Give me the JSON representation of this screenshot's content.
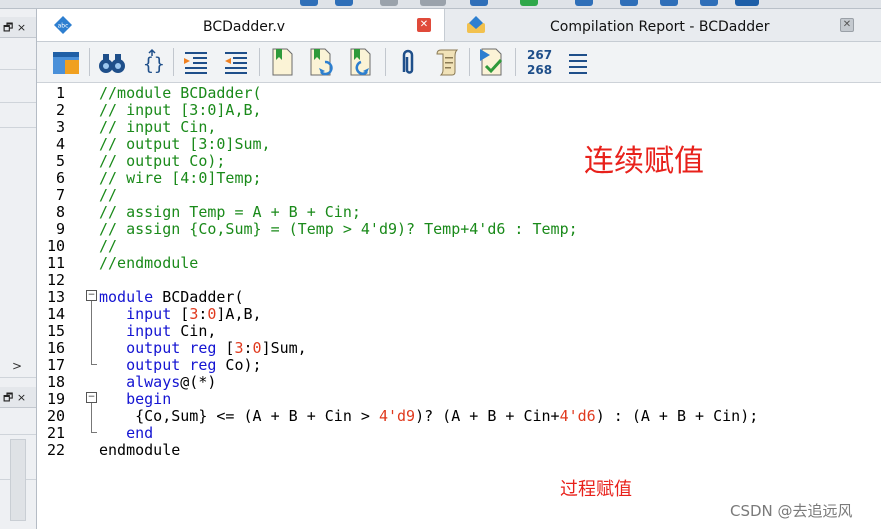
{
  "tabs": [
    {
      "label": "BCDadder.v",
      "icon": "verilog-file-icon",
      "active": true
    },
    {
      "label": "Compilation Report - BCDadder",
      "icon": "report-icon",
      "active": false
    }
  ],
  "left_panel": {
    "restore_glyph": "🗗 ×",
    "arrow": ">"
  },
  "toolbar": {
    "buttons": [
      "open-icon",
      "find-icon",
      "brace-icon",
      "indent-icon",
      "unindent-icon",
      "bookmark-icon",
      "bookmark-next-icon",
      "bookmark-prev-icon",
      "clip-icon",
      "scroll-icon",
      "run-check-icon",
      "line-numbers-icon",
      "list-icon"
    ],
    "line_numbers": [
      "267",
      "268"
    ]
  },
  "line_numbers": [
    "1",
    "2",
    "3",
    "4",
    "5",
    "6",
    "7",
    "8",
    "9",
    "10",
    "11",
    "12",
    "13",
    "14",
    "15",
    "16",
    "17",
    "18",
    "19",
    "20",
    "21",
    "22"
  ],
  "code_lines": [
    [
      {
        "t": "//module BCDadder(",
        "c": "com"
      }
    ],
    [
      {
        "t": "// input [3:0]A,B,",
        "c": "com"
      }
    ],
    [
      {
        "t": "// input Cin,",
        "c": "com"
      }
    ],
    [
      {
        "t": "// output [3:0]Sum,",
        "c": "com"
      }
    ],
    [
      {
        "t": "// output Co);",
        "c": "com"
      }
    ],
    [
      {
        "t": "// wire [4:0]Temp;",
        "c": "com"
      }
    ],
    [
      {
        "t": "//",
        "c": "com"
      }
    ],
    [
      {
        "t": "// assign Temp = A + B + Cin;",
        "c": "com"
      }
    ],
    [
      {
        "t": "// assign {Co,Sum} = (Temp > 4'd9)? Temp+4'd6 : Temp;",
        "c": "com"
      }
    ],
    [
      {
        "t": "//",
        "c": "com"
      }
    ],
    [
      {
        "t": "//endmodule",
        "c": "com"
      }
    ],
    [
      {
        "t": "",
        "c": "txt"
      }
    ],
    [
      {
        "t": "module",
        "c": "kw"
      },
      {
        "t": " BCDadder(",
        "c": "txt"
      }
    ],
    [
      {
        "t": "   ",
        "c": "txt"
      },
      {
        "t": "input",
        "c": "kw"
      },
      {
        "t": " [",
        "c": "txt"
      },
      {
        "t": "3",
        "c": "num"
      },
      {
        "t": ":",
        "c": "txt"
      },
      {
        "t": "0",
        "c": "num"
      },
      {
        "t": "]A,B,",
        "c": "txt"
      }
    ],
    [
      {
        "t": "   ",
        "c": "txt"
      },
      {
        "t": "input",
        "c": "kw"
      },
      {
        "t": " Cin,",
        "c": "txt"
      }
    ],
    [
      {
        "t": "   ",
        "c": "txt"
      },
      {
        "t": "output",
        "c": "kw"
      },
      {
        "t": " ",
        "c": "txt"
      },
      {
        "t": "reg",
        "c": "kw"
      },
      {
        "t": " [",
        "c": "txt"
      },
      {
        "t": "3",
        "c": "num"
      },
      {
        "t": ":",
        "c": "txt"
      },
      {
        "t": "0",
        "c": "num"
      },
      {
        "t": "]Sum,",
        "c": "txt"
      }
    ],
    [
      {
        "t": "   ",
        "c": "txt"
      },
      {
        "t": "output",
        "c": "kw"
      },
      {
        "t": " ",
        "c": "txt"
      },
      {
        "t": "reg",
        "c": "kw"
      },
      {
        "t": " Co);",
        "c": "txt"
      }
    ],
    [
      {
        "t": "   ",
        "c": "txt"
      },
      {
        "t": "always",
        "c": "kw"
      },
      {
        "t": "@(*)",
        "c": "txt"
      }
    ],
    [
      {
        "t": "   ",
        "c": "txt"
      },
      {
        "t": "begin",
        "c": "kw"
      }
    ],
    [
      {
        "t": "    {Co,Sum} <= (A + B + Cin > ",
        "c": "txt"
      },
      {
        "t": "4'd9",
        "c": "num"
      },
      {
        "t": ")? (A + B + Cin+",
        "c": "txt"
      },
      {
        "t": "4'd6",
        "c": "num"
      },
      {
        "t": ") : (A + B + Cin);",
        "c": "txt"
      }
    ],
    [
      {
        "t": "   ",
        "c": "txt"
      },
      {
        "t": "end",
        "c": "kw"
      }
    ],
    [
      {
        "t": "endmodule",
        "c": "txt"
      }
    ]
  ],
  "annotations": {
    "top": "连续赋值",
    "bottom": "过程赋值"
  },
  "watermark": "CSDN @去追远风",
  "colors": {
    "comment": "#1a8a1a",
    "keyword": "#1414d2",
    "number": "#e03a1e",
    "annotation": "#e8211b"
  }
}
